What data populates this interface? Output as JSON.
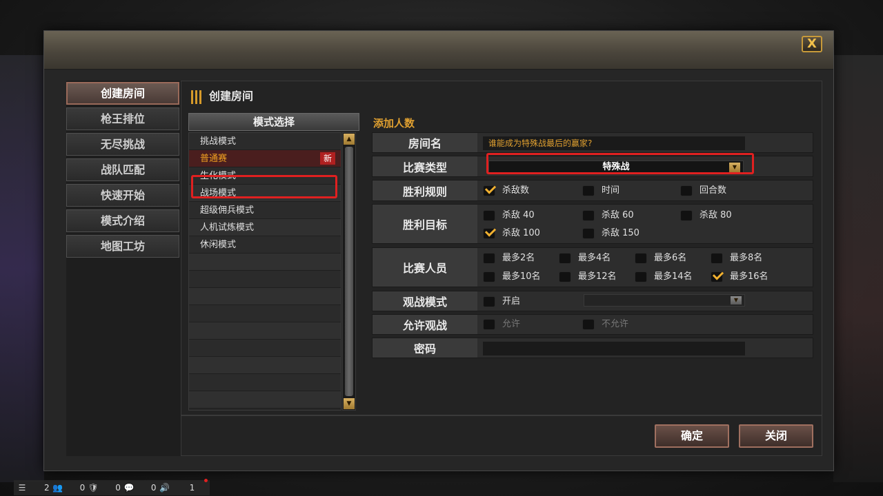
{
  "dialog": {
    "close_label": "X"
  },
  "nav": {
    "items": [
      {
        "label": "创建房间",
        "active": true
      },
      {
        "label": "枪王排位"
      },
      {
        "label": "无尽挑战"
      },
      {
        "label": "战队匹配"
      },
      {
        "label": "快速开始"
      },
      {
        "label": "模式介绍"
      },
      {
        "label": "地图工坊"
      }
    ]
  },
  "panel": {
    "title": "创建房间"
  },
  "modes": {
    "header": "模式选择",
    "items": [
      {
        "label": "挑战模式"
      },
      {
        "label": "普通赛",
        "selected": true,
        "badge": "新"
      },
      {
        "label": "生化模式"
      },
      {
        "label": "战场模式"
      },
      {
        "label": "超级佣兵模式"
      },
      {
        "label": "人机试炼模式"
      },
      {
        "label": "休闲模式"
      }
    ],
    "scroll_up": "▲",
    "scroll_down": "▼"
  },
  "settings": {
    "title": "添加人数",
    "room_name": {
      "label": "房间名",
      "value": "谁能成为特殊战最后的赢家?"
    },
    "match_type": {
      "label": "比赛类型",
      "value": "特殊战",
      "arrow": "▼"
    },
    "win_rule": {
      "label": "胜利规则",
      "options": [
        {
          "label": "杀敌数",
          "checked": true
        },
        {
          "label": "时间",
          "checked": false
        },
        {
          "label": "回合数",
          "checked": false
        }
      ]
    },
    "win_target": {
      "label": "胜利目标",
      "options": [
        {
          "label": "杀敌 40",
          "checked": false
        },
        {
          "label": "杀敌 60",
          "checked": false
        },
        {
          "label": "杀敌 80",
          "checked": false
        },
        {
          "label": "杀敌 100",
          "checked": true
        },
        {
          "label": "杀敌 150",
          "checked": false
        }
      ]
    },
    "players": {
      "label": "比赛人员",
      "options": [
        {
          "label": "最多2名",
          "checked": false
        },
        {
          "label": "最多4名",
          "checked": false
        },
        {
          "label": "最多6名",
          "checked": false
        },
        {
          "label": "最多8名",
          "checked": false
        },
        {
          "label": "最多10名",
          "checked": false
        },
        {
          "label": "最多12名",
          "checked": false
        },
        {
          "label": "最多14名",
          "checked": false
        },
        {
          "label": "最多16名",
          "checked": true
        }
      ]
    },
    "spectate_mode": {
      "label": "观战模式",
      "option": "开启",
      "arrow": "▼"
    },
    "allow_spectate": {
      "label": "允许观战",
      "options": [
        "允许",
        "不允许"
      ]
    },
    "password": {
      "label": "密码"
    }
  },
  "footer": {
    "confirm_label": "确定",
    "close_label": "关闭"
  },
  "taskbar": {
    "menu_icon": "☰",
    "friends_count": "2",
    "friends_icon": "👥",
    "shield_count": "0",
    "shield_icon": "🛡",
    "chat_count": "0",
    "chat_icon": "💬",
    "voice_count": "0",
    "voice_icon": "🔊",
    "notify_count": "1"
  }
}
